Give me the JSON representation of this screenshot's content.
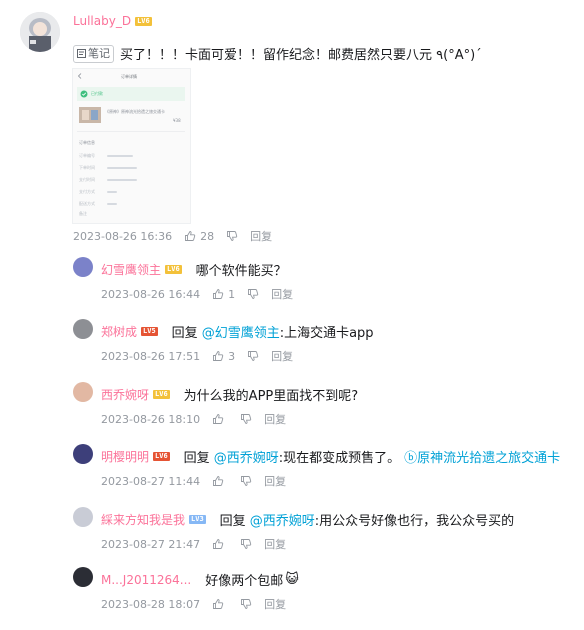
{
  "post": {
    "username": "Lullaby_D",
    "level": "LV6",
    "note_badge": "笔记",
    "text": "买了！！！卡面可爱！！留作纪念！邮费居然只要八元 ٩(°A°)ˊ",
    "date": "2023-08-26 16:36",
    "likes": "28",
    "reply_label": "回复",
    "screenshot": {
      "title": "订单详情",
      "status": "已付款",
      "item": "《原神》原神流光拾遗之旅交通卡",
      "price": "¥38",
      "section": "订单信息",
      "rows": [
        "订单编号",
        "下单时间",
        "支付时间",
        "支付方式",
        "配送方式",
        "备注"
      ]
    }
  },
  "replies": [
    {
      "username": "幻雪鹰领主",
      "level": "LV6",
      "level_color": "yellow",
      "text": "哪个软件能买？",
      "date": "2023-08-26 16:44",
      "likes": "1",
      "reply_label": "回复",
      "avatar_color": "#7b82c9"
    },
    {
      "username": "郑树成",
      "level": "LV5",
      "level_color": "red",
      "prefix": "回复",
      "mention": "@幻雪鹰领主",
      "text": ":上海交通卡app",
      "date": "2023-08-26 17:51",
      "likes": "3",
      "reply_label": "回复",
      "avatar_color": "#8d8f94"
    },
    {
      "username": "西乔婉呀",
      "level": "LV6",
      "level_color": "yellow",
      "text": "为什么我的APP里面找不到呢?",
      "date": "2023-08-26 18:10",
      "likes": "",
      "reply_label": "回复",
      "avatar_color": "#e2b8a3"
    },
    {
      "username": "明樱明明",
      "level": "LV6",
      "level_color": "red",
      "prefix": "回复",
      "mention": "@西乔婉呀",
      "text": ":现在都变成预售了。",
      "link": "原神流光拾遗之旅交通卡",
      "date": "2023-08-27 11:44",
      "likes": "",
      "reply_label": "回复",
      "avatar_color": "#3d3f7a"
    },
    {
      "username": "綵来方知我是我",
      "level": "LV3",
      "level_color": "blue",
      "prefix": "回复",
      "mention": "@西乔婉呀",
      "text": ":用公众号好像也行，我公众号买的",
      "date": "2023-08-27 21:47",
      "likes": "",
      "reply_label": "回复",
      "avatar_color": "#c9ccd6"
    },
    {
      "username": "M...J2011264...",
      "text": "好像两个包邮",
      "emoji": "😺",
      "date": "2023-08-28 18:07",
      "likes": "",
      "reply_label": "回复",
      "avatar_color": "#2b2d35"
    }
  ],
  "colors": {
    "mention": "#00a1d6",
    "post_username": "#fb7299",
    "reply_username": "#fb7299",
    "meta": "#9499a0"
  }
}
